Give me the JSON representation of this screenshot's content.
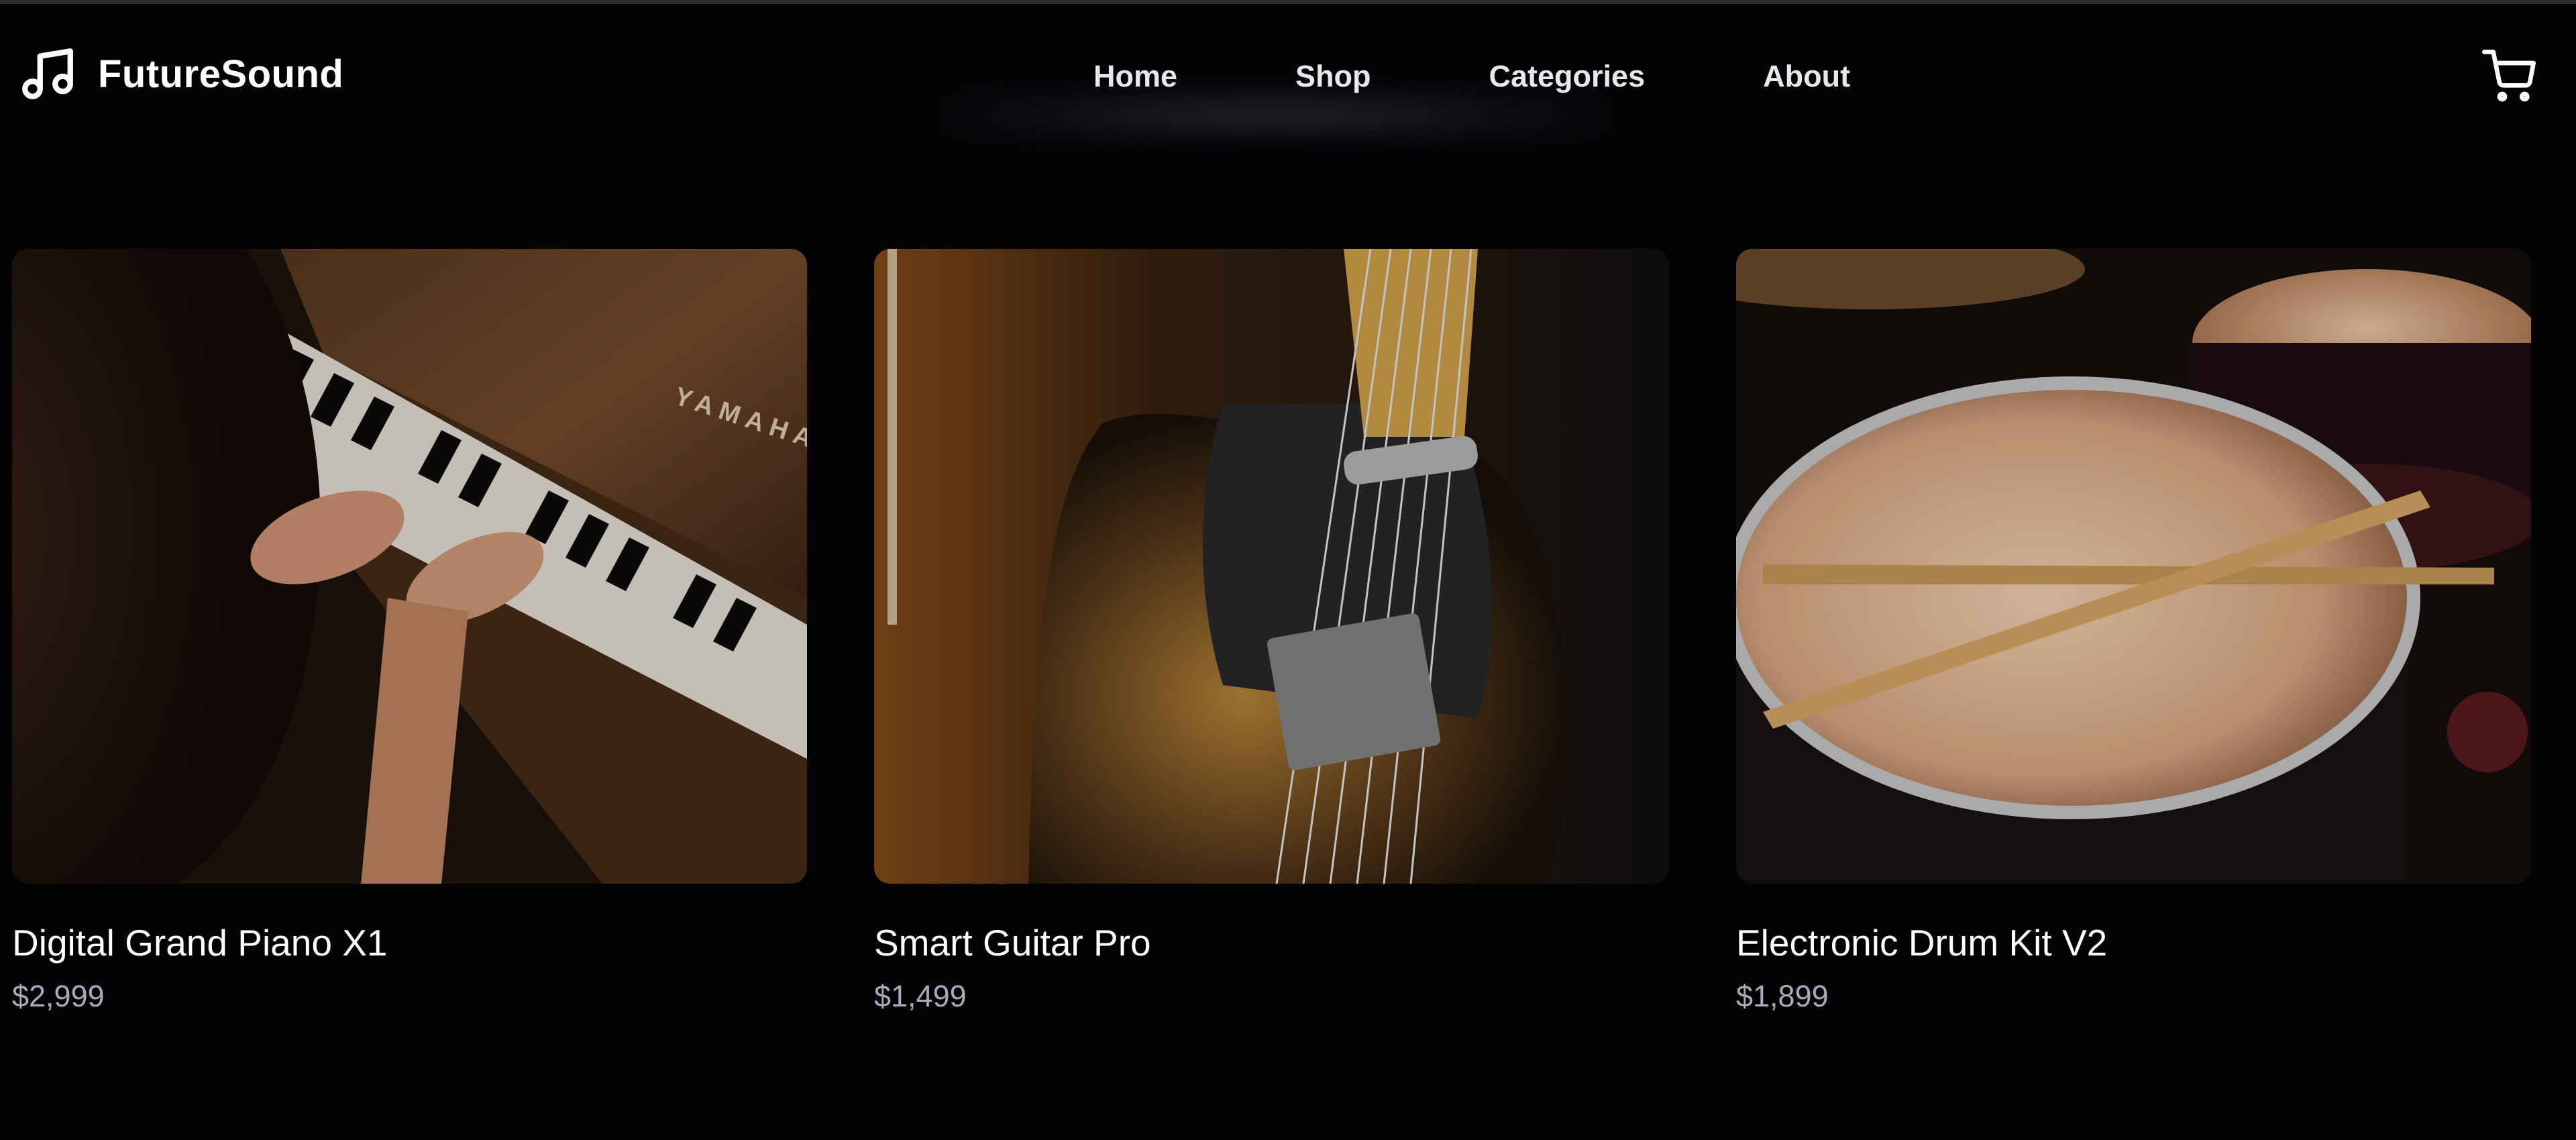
{
  "brand": {
    "name": "FutureSound",
    "icon": "music-note-icon"
  },
  "nav": {
    "items": [
      {
        "label": "Home"
      },
      {
        "label": "Shop"
      },
      {
        "label": "Categories"
      },
      {
        "label": "About"
      }
    ]
  },
  "cart": {
    "icon": "shopping-cart-icon"
  },
  "products": [
    {
      "title": "Digital Grand Piano X1",
      "price": "$2,999",
      "image_subject": "piano-photo",
      "image_brand_text": "YAMAHA"
    },
    {
      "title": "Smart Guitar Pro",
      "price": "$1,499",
      "image_subject": "guitar-photo"
    },
    {
      "title": "Electronic Drum Kit V2",
      "price": "$1,899",
      "image_subject": "drum-kit-photo"
    }
  ],
  "colors": {
    "background": "#030306",
    "text": "#ffffff",
    "price": "#a8acb8"
  }
}
